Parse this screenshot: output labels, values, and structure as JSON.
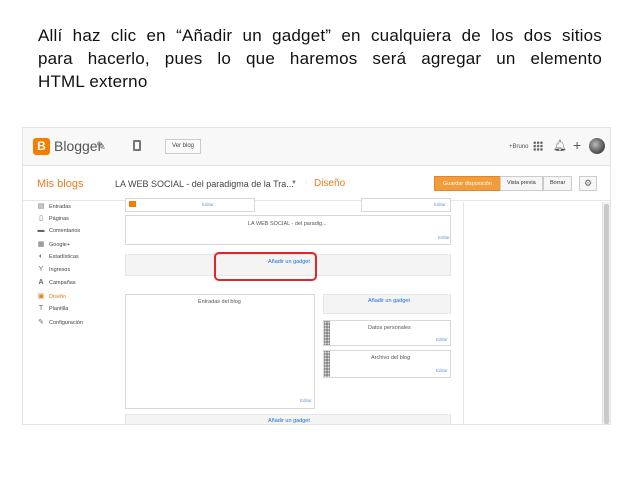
{
  "caption": {
    "line1": "Allí haz clic en “Añadir un gadget” en cualquiera de los dos sitios",
    "line2": "para hacerlo, pues lo que haremos será agregar un elemento",
    "line3": "HTML externo"
  },
  "topbar": {
    "brand": "Blogger",
    "ver_blog": "Ver blog",
    "user": "+Bruno",
    "icons": [
      "pencil-icon",
      "pages-icon",
      "apps-icon",
      "bell-icon",
      "plus-icon"
    ]
  },
  "subbar": {
    "mis_blogs": "Mis blogs",
    "blog_title": "LA WEB SOCIAL - del paradigma de la Tra...",
    "separator": "·",
    "section": "Diseño",
    "save_label": "Guardar disposición",
    "preview_label": "Vista previa",
    "delete_label": "Borrar"
  },
  "sidebar": {
    "items": [
      {
        "label": "Entradas",
        "icon": "entries-icon"
      },
      {
        "label": "Páginas",
        "icon": "pages-icon"
      },
      {
        "label": "Comentarios",
        "icon": "comments-icon"
      },
      {
        "label": "Google+",
        "icon": "googleplus-icon"
      },
      {
        "label": "Estadísticas",
        "icon": "stats-icon"
      },
      {
        "label": "Ingresos",
        "icon": "trophy-icon"
      },
      {
        "label": "Campañas",
        "icon": "campaigns-icon"
      },
      {
        "label": "Diseño",
        "icon": "layout-icon",
        "active": true
      },
      {
        "label": "Plantilla",
        "icon": "template-icon"
      },
      {
        "label": "Configuración",
        "icon": "wrench-icon"
      }
    ]
  },
  "layout": {
    "header_gadget": "LA WEB SOCIAL - del paradig...",
    "add_gadget": "Añadir un gadget",
    "add_gadget_sidebar": "Añadir un gadget",
    "add_gadget_bottom": "Añadir un gadget",
    "blog_posts": "Entradas del blog",
    "personal_data": "Datos personales",
    "blog_archive": "Archivo del blog",
    "edit": "Editar"
  },
  "colors": {
    "accent": "#e67e22",
    "highlight": "#e0262b",
    "link": "#1a6cd8"
  }
}
